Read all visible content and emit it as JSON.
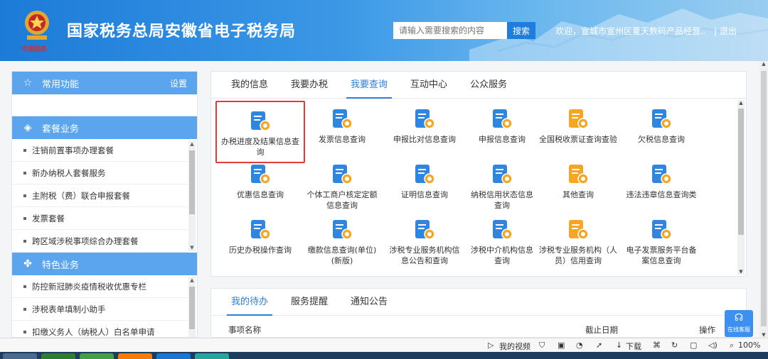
{
  "header": {
    "site_title": "国家税务总局安徽省电子税务局",
    "logo_caption": "中国税务",
    "search_placeholder": "请输入需要搜索的内容",
    "search_button": "搜索",
    "welcome_text": "欢迎，宣城市宣州区夏天数码产品经营...",
    "logout": "| 退出"
  },
  "sidebar": {
    "common": {
      "title": "常用功能",
      "settings": "设置"
    },
    "package": {
      "title": "套餐业务",
      "items": [
        "注销前置事项办理套餐",
        "新办纳税人套餐服务",
        "主附税（费）联合申报套餐",
        "发票套餐",
        "跨区域涉税事项综合办理套餐"
      ]
    },
    "feature": {
      "title": "特色业务",
      "items": [
        "防控新冠肺炎疫情税收优惠专栏",
        "涉税表单填制小助手",
        "扣缴义务人（纳税人）白名单申请"
      ]
    }
  },
  "main": {
    "tabs": [
      "我的信息",
      "我要办税",
      "我要查询",
      "互动中心",
      "公众服务"
    ],
    "active_tab": 2,
    "items": [
      {
        "label": "办税进度及结果信息查询",
        "icon": "magnifier-icon"
      },
      {
        "label": "发票信息查询",
        "icon": "invoice-search-icon"
      },
      {
        "label": "申报比对信息查询",
        "icon": "compare-search-icon"
      },
      {
        "label": "申报信息查询",
        "icon": "declare-search-icon"
      },
      {
        "label": "全国税收票证查询查验",
        "icon": "ticket-icon"
      },
      {
        "label": "欠税信息查询",
        "icon": "arrears-icon"
      },
      {
        "label": "优惠信息查询",
        "icon": "discount-search-icon"
      },
      {
        "label": "个体工商户核定定额信息查询",
        "icon": "merchant-icon"
      },
      {
        "label": "证明信息查询",
        "icon": "certificate-icon"
      },
      {
        "label": "纳税信用状态信息查询",
        "icon": "credit-icon"
      },
      {
        "label": "其他查询",
        "icon": "other-search-icon"
      },
      {
        "label": "违法违章信息查询类",
        "icon": "warning-icon"
      },
      {
        "label": "历史办税操作查询",
        "icon": "history-icon"
      },
      {
        "label": "缴款信息查询(单位)(新版)",
        "icon": "payment-user-icon"
      },
      {
        "label": "涉税专业服务机构信息公告和查询",
        "icon": "agency-notice-icon"
      },
      {
        "label": "涉税中介机构信息查询",
        "icon": "intermediary-icon"
      },
      {
        "label": "涉税专业服务机构（人员）信用查询",
        "icon": "agency-credit-icon"
      },
      {
        "label": "电子发票服务平台备案信息查询",
        "icon": "e-invoice-icon"
      }
    ]
  },
  "bottom": {
    "tabs": [
      "我的待办",
      "服务提醒",
      "通知公告"
    ],
    "active_tab": 0,
    "columns": [
      "事项名称",
      "截止日期",
      "操作"
    ]
  },
  "service_button": "在线客服",
  "statusbar": {
    "video": "我的视频",
    "download": "下载",
    "zoom": "100%"
  },
  "colors": {
    "accent": "#2a7fd9",
    "sidebar_bar": "#5ba5ee",
    "highlight": "#e53935",
    "icon_blue": "#2f86e0",
    "icon_orange": "#f5a623"
  }
}
